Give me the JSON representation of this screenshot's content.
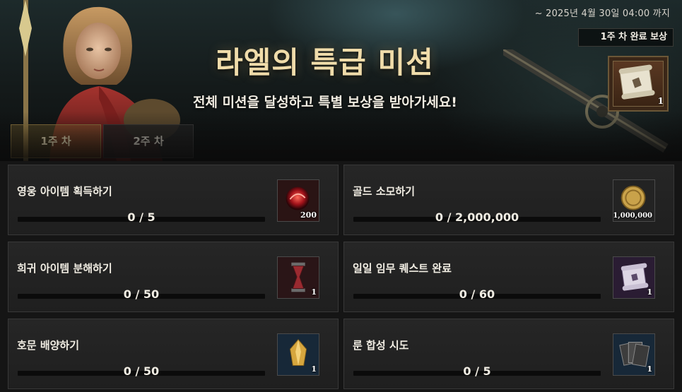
{
  "banner": {
    "deadline": "~ 2025년 4월 30일 04:00 까지",
    "title": "라엘의 특급 미션",
    "subtitle": "전체 미션을 달성하고 특별 보상을 받아가세요!",
    "reward_label": "1주 차 완료 보상",
    "reward_qty": "1",
    "reward_icon": "scroll-icon"
  },
  "tabs": [
    {
      "label": "1주 차",
      "active": true
    },
    {
      "label": "2주 차",
      "active": false
    }
  ],
  "missions": [
    {
      "name": "영웅 아이템 획득하기",
      "progress": "0 / 5",
      "fraction": 0,
      "item_icon": "red-orb-icon",
      "item_qty": "200"
    },
    {
      "name": "골드 소모하기",
      "progress": "0 / 2,000,000",
      "fraction": 0,
      "item_icon": "gold-coin-icon",
      "item_qty": "1,000,000"
    },
    {
      "name": "희귀 아이템 분해하기",
      "progress": "0 / 50",
      "fraction": 0,
      "item_icon": "hourglass-icon",
      "item_qty": "1"
    },
    {
      "name": "일일 임무 퀘스트 완료",
      "progress": "0 / 60",
      "fraction": 0,
      "item_icon": "purple-scroll-icon",
      "item_qty": "1"
    },
    {
      "name": "호문 배양하기",
      "progress": "0 / 50",
      "fraction": 0,
      "item_icon": "gold-crystal-icon",
      "item_qty": "1"
    },
    {
      "name": "룬 합성 시도",
      "progress": "0 / 5",
      "fraction": 0,
      "item_icon": "rune-cards-icon",
      "item_qty": "1"
    }
  ],
  "colors": {
    "accent": "#c7a862",
    "panel": "#222222",
    "border": "#383838"
  }
}
